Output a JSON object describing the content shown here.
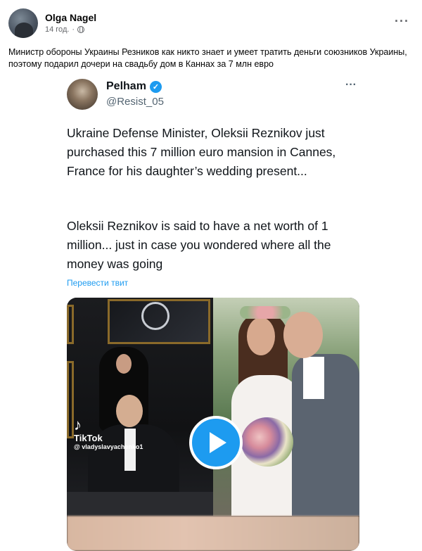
{
  "post": {
    "author": "Olga Nagel",
    "time": "14 год.",
    "visibility_icon": "globe-icon",
    "more_icon": "more-horizontal-icon",
    "text": "Министр обороны Украины Резников как никто знает и умеет тратить деньги союзников Украины, поэтому подарил дочери на свадьбу дом в Каннах за 7 млн евро"
  },
  "tweet": {
    "name": "Pelham",
    "handle": "@Resist_05",
    "verified_icon": "verified-badge-icon",
    "more": "···",
    "paragraph1": "Ukraine Defense Minister, Oleksii Reznikov just purchased this 7 million euro mansion in Cannes, France for his daughter’s wedding present...",
    "paragraph2": "Oleksii Reznikov is said to have a net worth of 1 million... just in case you wondered where all the money was going",
    "translate": "Перевести твит",
    "media": {
      "watermark_logo": "TikTok",
      "watermark_user": "@ vladyslavyaсhenko1",
      "play_icon": "play-icon",
      "accent": "#1d9bf0"
    }
  },
  "fb_more_label": "···"
}
